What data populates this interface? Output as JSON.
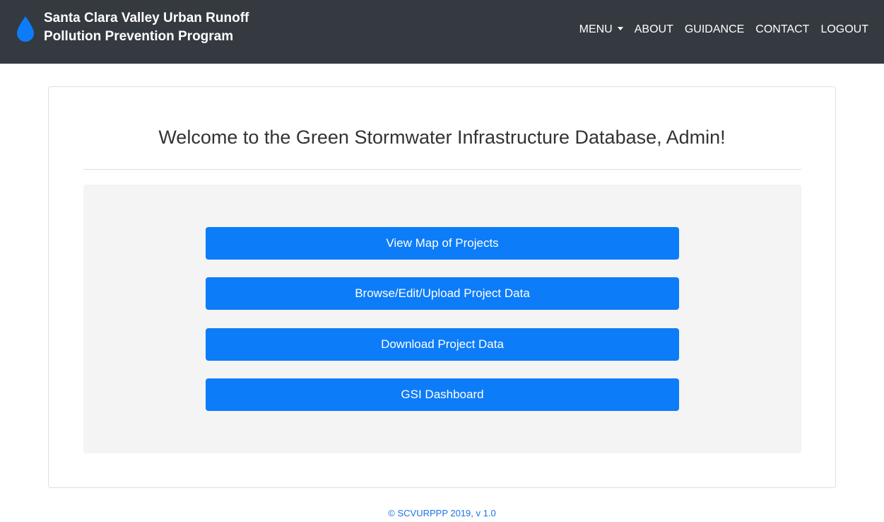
{
  "colors": {
    "navbar_bg": "#343a40",
    "accent": "#0d7cf8",
    "panel_bg": "#f4f4f4",
    "drop_icon": "#0d7cf8"
  },
  "header": {
    "logo_icon": "water-drop-icon",
    "title_line1": "Santa Clara Valley Urban Runoff",
    "title_line2": "Pollution Prevention Program",
    "nav": {
      "menu": "MENU",
      "about": "ABOUT",
      "guidance": "GUIDANCE",
      "contact": "CONTACT",
      "logout": "LOGOUT"
    }
  },
  "main": {
    "welcome": "Welcome to the Green Stormwater Infrastructure Database, Admin!",
    "buttons": [
      {
        "label": "View Map of Projects"
      },
      {
        "label": "Browse/Edit/Upload Project Data"
      },
      {
        "label": "Download Project Data"
      },
      {
        "label": "GSI Dashboard"
      }
    ]
  },
  "footer": {
    "text": "© SCVURPPP 2019, v 1.0"
  }
}
